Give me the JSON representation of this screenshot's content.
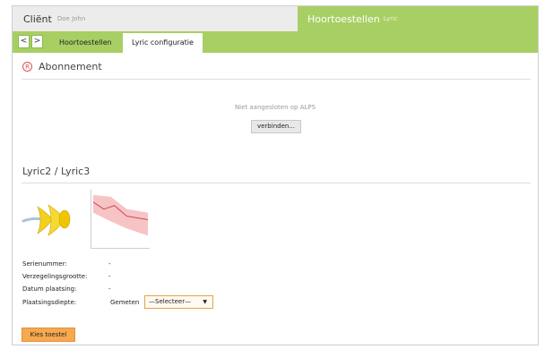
{
  "header": {
    "client_label": "Cliënt",
    "client_name": "Doe John",
    "devices_label": "Hoortoestellen",
    "devices_model": "Lyric"
  },
  "nav": {
    "back_glyph": "<",
    "forward_glyph": ">",
    "tabs": [
      {
        "label": "Hoortoestellen",
        "active": false
      },
      {
        "label": "Lyric configuratie",
        "active": true
      }
    ]
  },
  "subscription": {
    "title": "Abonnement",
    "status_text": "Niet aangesloten op ALPS",
    "connect_button": "verbinden..."
  },
  "device_section": {
    "title": "Lyric2 / Lyric3",
    "fields": [
      {
        "label": "Serienummer:",
        "value": "-"
      },
      {
        "label": "Verzegelingsgrootte:",
        "value": "-"
      },
      {
        "label": "Datum plaatsing:",
        "value": "-"
      },
      {
        "label": "Plaatsingsdiepte:",
        "value": ""
      }
    ],
    "measured_label": "Gemeten",
    "depth_select": "—Selecteer—",
    "choose_button": "Kies toestel"
  },
  "colors": {
    "accent_green": "#a8cf63",
    "button_orange": "#f6a94e",
    "registered_red": "#d9534f"
  },
  "icons": {
    "registered": "registered-mark-icon",
    "device": "lyric-device-icon",
    "chart": "fit-range-chart-icon",
    "caret": "caret-down-icon"
  }
}
